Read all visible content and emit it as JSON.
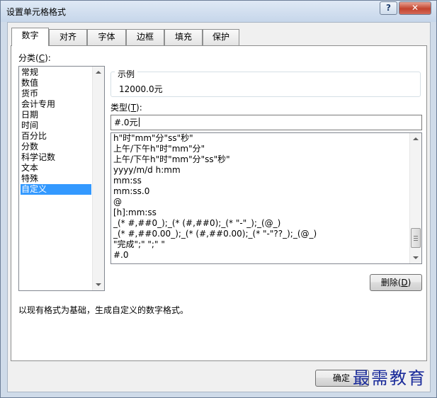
{
  "window": {
    "title": "设置单元格格式",
    "help_label": "?",
    "close_label": "✕"
  },
  "tabs": [
    {
      "label": "数字",
      "active": true
    },
    {
      "label": "对齐",
      "active": false
    },
    {
      "label": "字体",
      "active": false
    },
    {
      "label": "边框",
      "active": false
    },
    {
      "label": "填充",
      "active": false
    },
    {
      "label": "保护",
      "active": false
    }
  ],
  "category": {
    "label_prefix": "分类(",
    "label_key": "C",
    "label_suffix": "):",
    "items": [
      "常规",
      "数值",
      "货币",
      "会计专用",
      "日期",
      "时间",
      "百分比",
      "分数",
      "科学记数",
      "文本",
      "特殊",
      "自定义"
    ],
    "selected": "自定义"
  },
  "sample": {
    "legend": "示例",
    "value": "12000.0元"
  },
  "type": {
    "label_prefix": "类型(",
    "label_key": "T",
    "label_suffix": "):",
    "value": "#.0元"
  },
  "format_list": [
    "h\"时\"mm\"分\"ss\"秒\"",
    "上午/下午h\"时\"mm\"分\"",
    "上午/下午h\"时\"mm\"分\"ss\"秒\"",
    "yyyy/m/d h:mm",
    "mm:ss",
    "mm:ss.0",
    "@",
    "[h]:mm:ss",
    "_(* #,##0_);_(* (#,##0);_(* \"-\"_);_(@_)",
    "_(* #,##0.00_);_(* (#,##0.00);_(* \"-\"??_);_(@_)",
    "\"完成\";\" \";\" \"",
    "#.0"
  ],
  "delete_button": {
    "label_prefix": "删除(",
    "label_key": "D",
    "label_suffix": ")"
  },
  "description": "以现有格式为基础，生成自定义的数字格式。",
  "ok_button": "确定",
  "watermark": "最需教育"
}
